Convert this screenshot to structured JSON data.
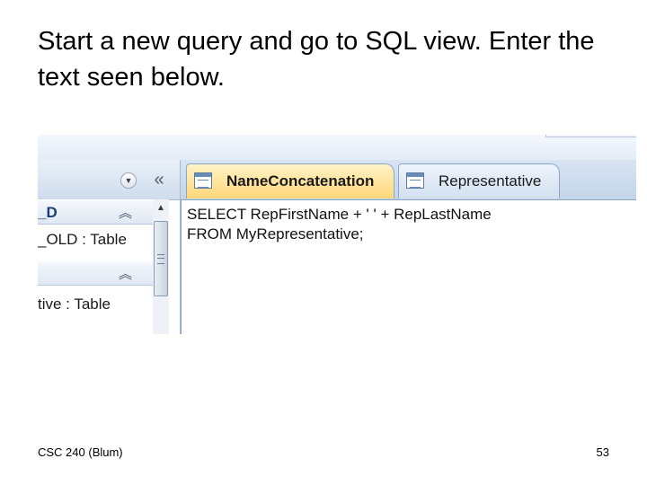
{
  "slide": {
    "title": "Start a new query and go to SQL view. Enter the text seen below.",
    "footer_left": "CSC 240 (Blum)",
    "page_number": "53"
  },
  "nav_pane": {
    "dropdown_icon": "chevron-down-icon",
    "collapse_icon": "double-chevron-left-icon",
    "groups": [
      {
        "label": "_D",
        "chevron": "double-chevron-up-icon",
        "items": [
          "_OLD : Table"
        ]
      },
      {
        "label": "",
        "chevron": "double-chevron-up-icon",
        "items": [
          "tive : Table"
        ]
      }
    ]
  },
  "tabs": [
    {
      "label": "NameConcatenation",
      "icon": "query-icon",
      "active": true
    },
    {
      "label": "Representative",
      "icon": "table-icon",
      "active": false
    }
  ],
  "sql": {
    "lines": [
      "SELECT RepFirstName + ' ' + RepLastName",
      "FROM MyRepresentative;"
    ]
  },
  "colors": {
    "active_tab": "#ffd77a",
    "pane_header": "#cfdcec",
    "group_label": "#1e3f75"
  }
}
